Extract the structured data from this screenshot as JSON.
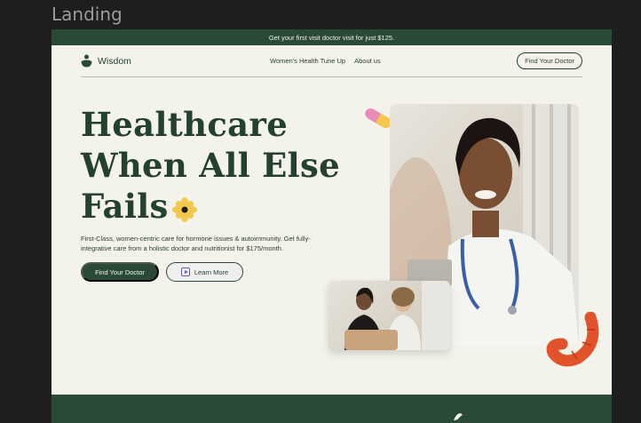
{
  "canvas": {
    "frame_label": "Landing"
  },
  "promo_bar": {
    "text": "Get your first visit doctor visit for just $125."
  },
  "nav": {
    "logo_text": "Wisdom",
    "links": [
      "Women's Health Tune Up",
      "About us"
    ],
    "cta_label": "Find Your Doctor"
  },
  "hero": {
    "title_lines": [
      "Healthcare",
      "When All Else",
      "Fails"
    ],
    "description": "First-Class, women-centric care for hormone issues & autoimmunity. Get fully-integrative care from a holistic doctor and nutritionist for $175/month.",
    "primary_cta": "Find Your Doctor",
    "secondary_cta": "Learn More"
  },
  "colors": {
    "brand_green": "#2b4a36",
    "background": "#f3f3ec",
    "accent_yellow": "#f2c94c",
    "accent_pink": "#e98ab8",
    "accent_orange": "#e2532b"
  },
  "icons": [
    "wisdom-logo-icon",
    "flower-icon",
    "play-icon",
    "pill-icon",
    "worm-icon"
  ]
}
